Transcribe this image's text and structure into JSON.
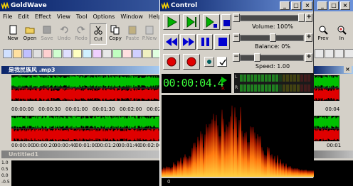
{
  "main": {
    "title": "GoldWave",
    "menu": [
      "File",
      "Edit",
      "Effect",
      "View",
      "Tool",
      "Options",
      "Window",
      "Help"
    ],
    "toolbar": [
      {
        "label": "New",
        "icon": "new-file-icon",
        "enabled": true
      },
      {
        "label": "Open",
        "icon": "open-folder-icon",
        "enabled": true
      },
      {
        "label": "Save",
        "icon": "save-disk-icon",
        "enabled": false
      },
      {
        "label": "Undo",
        "icon": "undo-icon",
        "enabled": false
      },
      {
        "label": "Redo",
        "icon": "redo-icon",
        "enabled": false
      },
      {
        "label": "Cut",
        "icon": "scissors-icon",
        "enabled": true
      },
      {
        "label": "Copy",
        "icon": "copy-icon",
        "enabled": true
      },
      {
        "label": "Paste",
        "icon": "paste-icon",
        "enabled": false
      },
      {
        "label": "P.New",
        "icon": "paste-new-icon",
        "enabled": false
      }
    ],
    "toolbar_right": [
      {
        "label": "Prev",
        "icon": "zoom-previous-icon"
      },
      {
        "label": "In",
        "icon": "zoom-in-icon"
      }
    ],
    "sound1": {
      "title": "是我民族风 .mp3",
      "ruler": [
        "00:00:00",
        "00:00:30",
        "00:01:00",
        "00:01:30",
        "00:02:00",
        "00:02:30"
      ],
      "ruler_right": "00:04",
      "ruler2": [
        "00:00:00",
        "00:00:20",
        "00:00:40",
        "00:01:00",
        "00:01:20",
        "00:01:40",
        "00:02:00"
      ],
      "ruler2_right": "00:01"
    },
    "sound2": {
      "title": "Untitled1",
      "scale": [
        "1.0",
        "0.5",
        "0.0",
        "-0.5"
      ]
    },
    "colors": {
      "left_channel": "#00c000",
      "right_channel": "#e00000",
      "title_active": "#0a246a"
    }
  },
  "control": {
    "title": "Control",
    "volume_label": "Volume: 100%",
    "balance_label": "Balance: 0%",
    "speed_label": "Speed: 1.00",
    "time": "00:00:04.4",
    "meter_labels": [
      "L",
      "R"
    ],
    "vis_scale": "0"
  }
}
